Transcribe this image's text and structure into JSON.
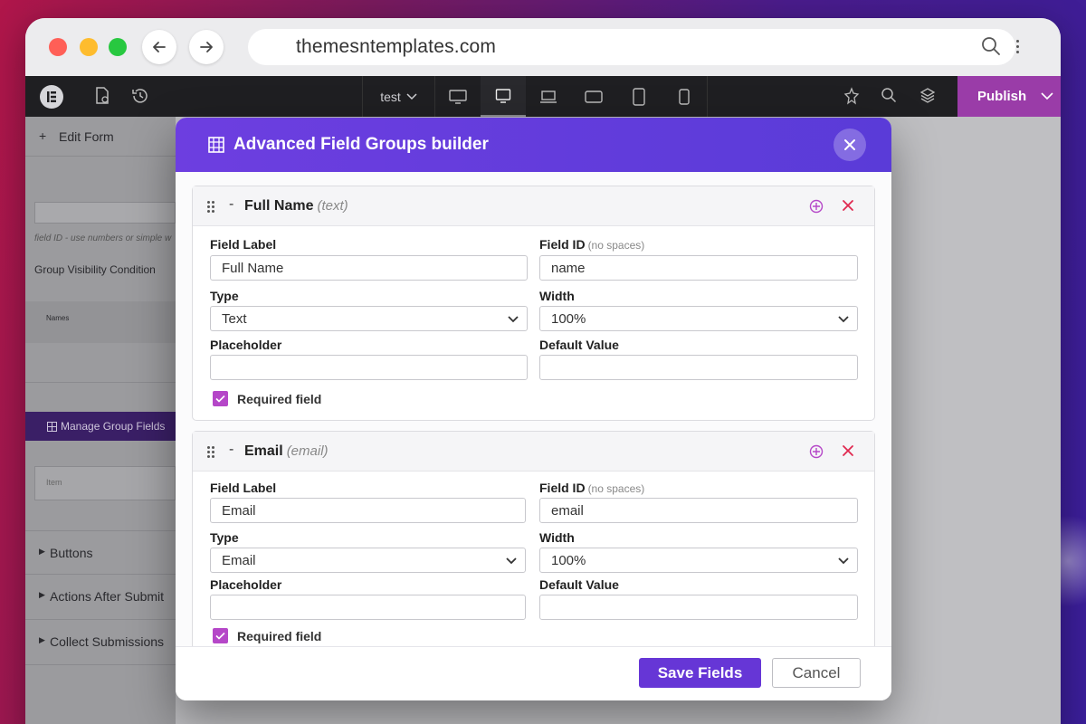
{
  "browser": {
    "url": "themesntemplates.com"
  },
  "editor_bar": {
    "page_dropdown": "test",
    "publish_label": "Publish"
  },
  "side_panel": {
    "edit_form": "Edit Form",
    "field_hint": "field ID - use numbers or simple w",
    "group_visibility": "Group Visibility Condition",
    "names_label": "Names",
    "manage_button": "Manage Group Fields",
    "select_placeholder": "Item",
    "sections": [
      "Buttons",
      "Actions After Submit",
      "Collect Submissions"
    ]
  },
  "modal": {
    "title": "Advanced Field Groups builder",
    "fields": [
      {
        "name": "Full Name",
        "type_tag": "(text)",
        "field_label_caption": "Field Label",
        "field_label_value": "Full Name",
        "field_id_caption": "Field ID",
        "field_id_hint": "(no spaces)",
        "field_id_value": "name",
        "type_caption": "Type",
        "type_value": "Text",
        "width_caption": "Width",
        "width_value": "100%",
        "placeholder_caption": "Placeholder",
        "placeholder_value": "",
        "default_caption": "Default Value",
        "default_value": "",
        "required_label": "Required field",
        "required": true
      },
      {
        "name": "Email",
        "type_tag": "(email)",
        "field_label_caption": "Field Label",
        "field_label_value": "Email",
        "field_id_caption": "Field ID",
        "field_id_hint": "(no spaces)",
        "field_id_value": "email",
        "type_caption": "Type",
        "type_value": "Email",
        "width_caption": "Width",
        "width_value": "100%",
        "placeholder_caption": "Placeholder",
        "placeholder_value": "",
        "default_caption": "Default Value",
        "default_value": "",
        "required_label": "Required field",
        "required": true
      }
    ],
    "save_label": "Save Fields",
    "cancel_label": "Cancel"
  },
  "colors": {
    "accent": "#6636d6",
    "header": "#6d3ee0",
    "checkbox": "#b547c8",
    "publish": "#9a3ca8",
    "delete": "#e0284f"
  }
}
